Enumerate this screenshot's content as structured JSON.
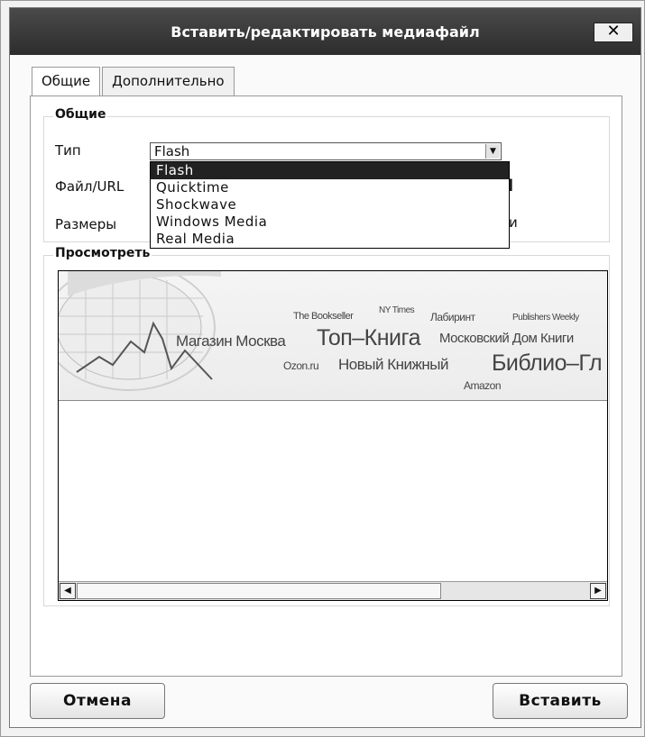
{
  "dialog": {
    "title": "Вставить/редактировать медиафайл",
    "close_symbol": "✕"
  },
  "tabs": [
    {
      "label": "Общие",
      "active": true
    },
    {
      "label": "Дополнительно",
      "active": false
    }
  ],
  "general": {
    "legend": "Общие",
    "type_label": "Тип",
    "type_value": "Flash",
    "file_label": "Файл/URL",
    "size_label": "Размеры",
    "size_trailing_text": "и",
    "type_options": [
      "Flash",
      "Quicktime",
      "Shockwave",
      "Windows Media",
      "Real Media"
    ],
    "selected_option": "Flash"
  },
  "preview": {
    "legend": "Просмотреть",
    "banner_words": [
      "The Bookseller",
      "NY Times",
      "Лабиринт",
      "Publishers Weekly",
      "Магазин Москва",
      "Топ–Книга",
      "Московский Дом Книги",
      "Ozon.ru",
      "Новый Книжный",
      "Библио–Гл",
      "Amazon"
    ]
  },
  "footer": {
    "cancel_label": "Отмена",
    "insert_label": "Вставить"
  },
  "icons": {
    "close": "close-icon",
    "dropdown_arrow": "chevron-down-icon",
    "scroll_left": "arrow-left-icon",
    "scroll_right": "arrow-right-icon"
  }
}
